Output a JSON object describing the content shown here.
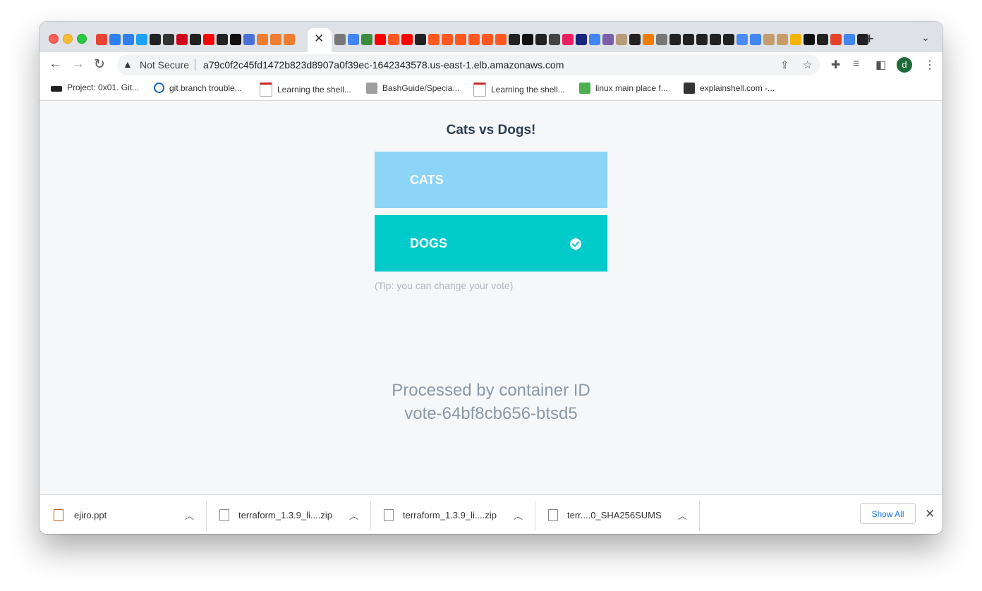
{
  "browser": {
    "active_tab_close": "✕",
    "new_tab": "+",
    "tab_menu": "⌄",
    "security_label": "Not Secure",
    "url": "a79c0f2c45fd1472b823d8907a0f39ec-1642343578.us-east-1.elb.amazonaws.com",
    "profile_initial": "d"
  },
  "bookmarks": [
    {
      "label": "Project: 0x01. Git..."
    },
    {
      "label": "git branch trouble..."
    },
    {
      "label": "Learning the shell..."
    },
    {
      "label": "BashGuide/Specia..."
    },
    {
      "label": "Learning the shell..."
    },
    {
      "label": "linux main place f..."
    },
    {
      "label": "explainshell.com -..."
    }
  ],
  "app": {
    "title": "Cats vs Dogs!",
    "option_a": "CATS",
    "option_b": "DOGS",
    "selected": "DOGS",
    "tip": "(Tip: you can change your vote)",
    "processed_line1": "Processed by container ID",
    "processed_line2": "vote-64bf8cb656-btsd5"
  },
  "colors": {
    "cats_button": "#8dd5f7",
    "dogs_button": "#00cbca",
    "title_text": "#2c3e50"
  },
  "downloads": {
    "items": [
      {
        "name": "ejiro.ppt"
      },
      {
        "name": "terraform_1.3.9_li....zip"
      },
      {
        "name": "terraform_1.3.9_li....zip"
      },
      {
        "name": "terr....0_SHA256SUMS"
      }
    ],
    "show_all": "Show All"
  }
}
